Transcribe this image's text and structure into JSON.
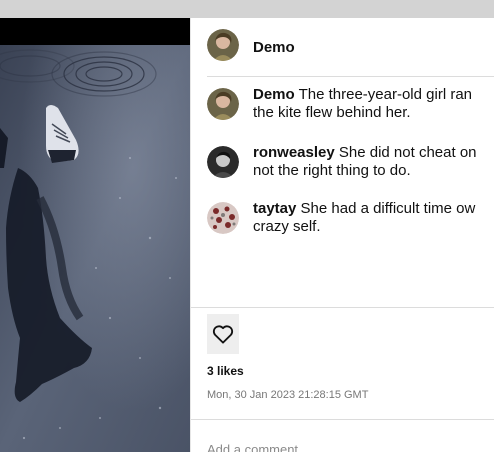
{
  "post": {
    "author": "Demo",
    "likes_label": "3 likes",
    "timestamp": "Mon, 30 Jan 2023 21:28:15 GMT"
  },
  "comments": [
    {
      "user": "Demo",
      "line1": "The three-year-old girl ran",
      "line2": "the kite flew behind her."
    },
    {
      "user": "ronweasley",
      "line1": "She did not cheat on",
      "line2": "not the right thing to do."
    },
    {
      "user": "taytay",
      "line1": "She had a difficult time ow",
      "line2": "crazy self."
    }
  ],
  "composer": {
    "placeholder": "Add a comment..."
  },
  "icons": {
    "like": "heart-outline-icon"
  }
}
